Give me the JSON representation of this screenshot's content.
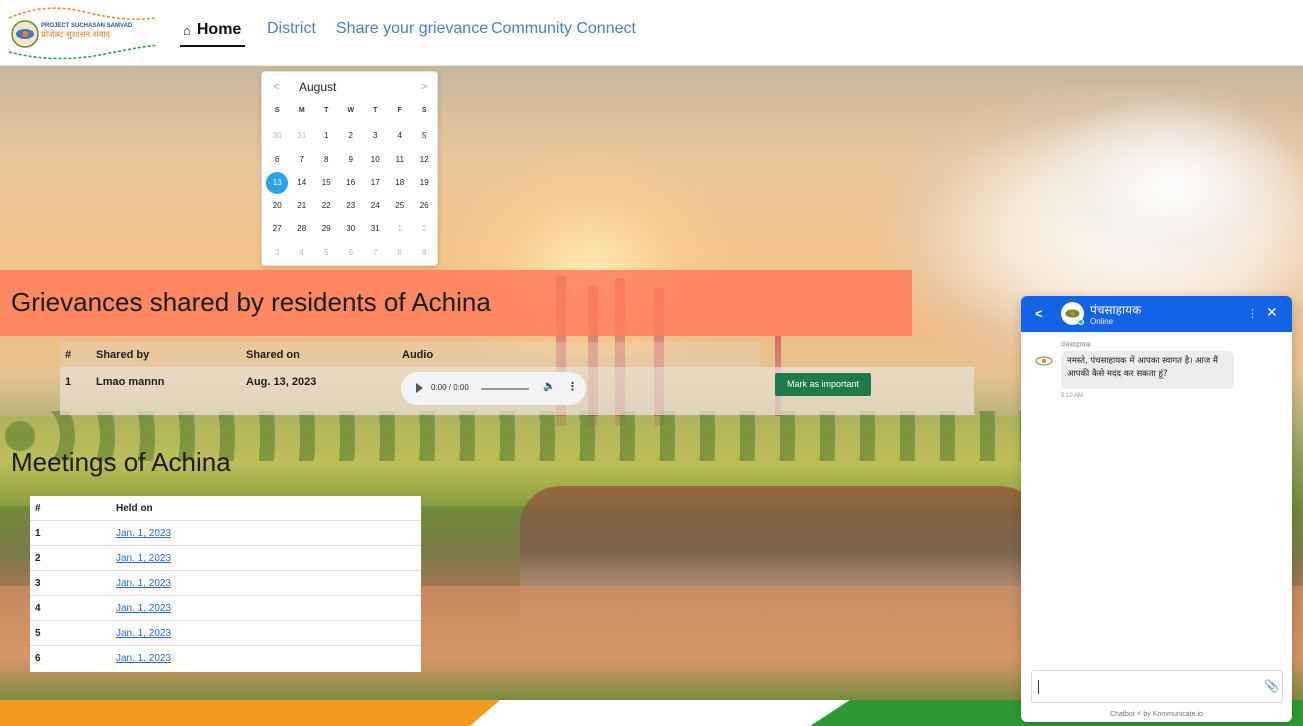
{
  "nav": {
    "logo_text_top": "PROJECT SUCHASAN SAMVAD",
    "logo_text_main": "प्रोजेक्ट सुशासन संवाद",
    "home": "Home",
    "district": "District",
    "share": "Share your grievance",
    "community": "Community Connect"
  },
  "calendar": {
    "month": "August",
    "prev": "<",
    "next": ">",
    "weekdays": [
      "S",
      "M",
      "T",
      "W",
      "T",
      "F",
      "S"
    ],
    "weeks": [
      [
        "30",
        "31",
        "1",
        "2",
        "3",
        "4",
        "5"
      ],
      [
        "6",
        "7",
        "8",
        "9",
        "10",
        "11",
        "12"
      ],
      [
        "13",
        "14",
        "15",
        "16",
        "17",
        "18",
        "19"
      ],
      [
        "20",
        "21",
        "22",
        "23",
        "24",
        "25",
        "26"
      ],
      [
        "27",
        "28",
        "29",
        "30",
        "31",
        "1",
        "2"
      ],
      [
        "3",
        "4",
        "5",
        "6",
        "7",
        "8",
        "9"
      ]
    ],
    "selected": "13"
  },
  "grievances": {
    "title": "Grievances shared by residents of Achina",
    "headers": {
      "num": "#",
      "shared_by": "Shared by",
      "shared_on": "Shared on",
      "audio": "Audio"
    },
    "rows": [
      {
        "num": "1",
        "shared_by": "Lmao mannn",
        "shared_on": "Aug. 13, 2023",
        "audio_time": "0:00 / 0:00",
        "action": "Mark as important"
      }
    ]
  },
  "meetings": {
    "title": "Meetings of Achina",
    "headers": {
      "num": "#",
      "held_on": "Held on"
    },
    "rows": [
      {
        "num": "1",
        "held_on": "Jan. 1, 2023"
      },
      {
        "num": "2",
        "held_on": "Jan. 1, 2023"
      },
      {
        "num": "3",
        "held_on": "Jan. 1, 2023"
      },
      {
        "num": "4",
        "held_on": "Jan. 1, 2023"
      },
      {
        "num": "5",
        "held_on": "Jan. 1, 2023"
      },
      {
        "num": "6",
        "held_on": "Jan. 1, 2023"
      }
    ]
  },
  "chatbot": {
    "name": "पंचसाहायक",
    "status": "Online",
    "sender": "पंचसाहायक",
    "message": "नमस्ते, पंचसाहायक में आपका स्वागत है। आज मैं आपकी कैसे मदद कर सकता हूं?",
    "time": "5:10 AM",
    "footer": "Chatbot ⚡ by Kommunicate.io"
  },
  "colors": {
    "nav_link": "#4a7fc1",
    "grievance_banner": "#ff7e5a",
    "mark_button": "#1d7a4b",
    "chat_header": "#1363e6",
    "calendar_selected": "#29a3e9",
    "meeting_link": "#2b6cc4"
  }
}
